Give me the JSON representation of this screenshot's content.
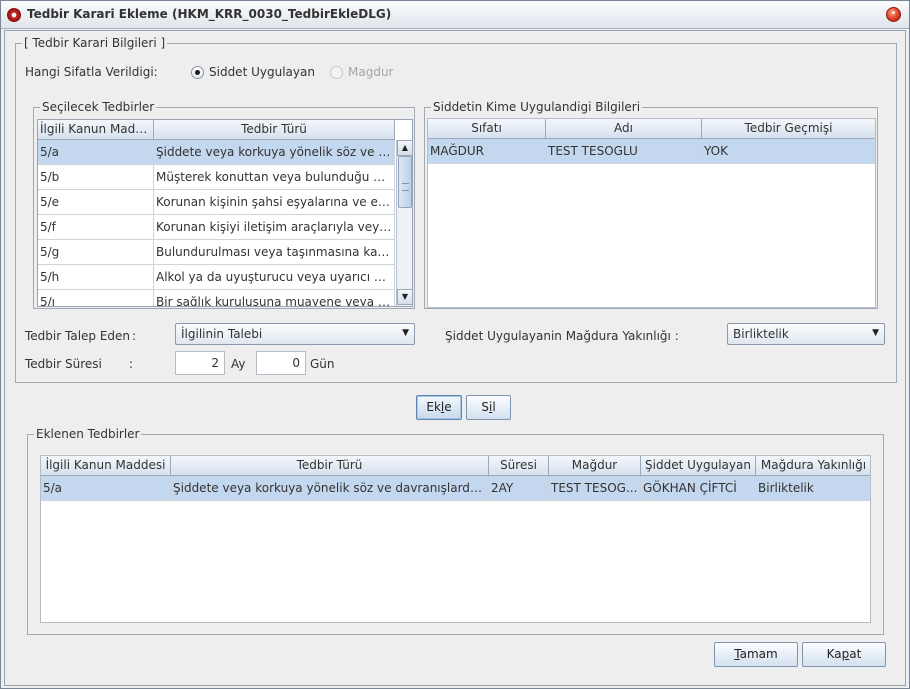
{
  "window": {
    "title": "Tedbir Karari Ekleme (HKM_KRR_0030_TedbirEkleDLG)"
  },
  "info_group": {
    "legend": "[ Tedbir Karari Bilgileri ]",
    "capacity_label": "Hangi Sifatla Verildigi:",
    "radio_perpetrator": "Siddet Uygulayan",
    "radio_victim": "Magdur",
    "selected_radio": "Siddet Uygulayan"
  },
  "measures_group": {
    "legend": "Seçilecek Tedbirler",
    "columns": [
      "İlgili Kanun Madde...",
      "Tedbir Türü"
    ],
    "rows": [
      {
        "article": "5/a",
        "type": "Şiddete veya korkuya yönelik söz ve davra...",
        "selected": true
      },
      {
        "article": "5/b",
        "type": "Müşterek konuttan veya bulunduğu yerden...",
        "selected": false
      },
      {
        "article": "5/e",
        "type": "Korunan kişinin şahsi eşyalarına ve ev eş...",
        "selected": false
      },
      {
        "article": "5/f",
        "type": "Korunan kişiyi iletişim araçlarıyla veya sai...",
        "selected": false
      },
      {
        "article": "5/g",
        "type": "Bulundurulması veya taşınmasına kanun...",
        "selected": false
      },
      {
        "article": "5/h",
        "type": "Alkol ya da uyuşturucu veya uyarıcı madde...",
        "selected": false
      },
      {
        "article": "5/ı",
        "type": "Bir sağlık kuruluşuna muayene veya tedav...",
        "selected": false
      }
    ],
    "scroll": {
      "up_icon": "▲",
      "down_icon": "▼"
    }
  },
  "applied_group": {
    "legend": "Siddetin Kime Uygulandigi Bilgileri",
    "columns": [
      "Sıfatı",
      "Adı",
      "Tedbir Geçmişi"
    ],
    "rows": [
      {
        "role": "MAĞDUR",
        "name": "TEST TESOGLU",
        "history": "YOK",
        "selected": true
      }
    ]
  },
  "form": {
    "requester_label": "Tedbir Talep Eden",
    "requester_colon": ":",
    "requester_value": "İlgilinin Talebi",
    "closeness_label": "Şiddet Uygulayanin Mağdura Yakınlığı :",
    "closeness_value": "Birliktelik",
    "duration_label": "Tedbir Süresi",
    "duration_colon": ":",
    "months_value": "2",
    "months_unit": "Ay",
    "days_value": "0",
    "days_unit": "Gün",
    "dropdown_icon": "▼"
  },
  "actions": {
    "add_label_pre": "Ek",
    "add_label_mn": "l",
    "add_label_post": "e",
    "delete_label_pre": "S",
    "delete_label_mn": "i",
    "delete_label_post": "l"
  },
  "added_group": {
    "legend": "Eklenen Tedbirler",
    "columns": [
      "İlgili Kanun Maddesi",
      "Tedbir Türü",
      "Süresi",
      "Mağdur",
      "Şiddet Uygulayan",
      "Mağdura Yakınlığı"
    ],
    "rows": [
      {
        "article": "5/a",
        "type": "Şiddete veya korkuya yönelik söz ve davranışlarda bulun...",
        "duration": "2AY",
        "victim": "TEST TESOG...",
        "perpetrator": "GÖKHAN ÇİFTCİ",
        "closeness": "Birliktelik",
        "selected": true
      }
    ]
  },
  "footer": {
    "ok_mn": "T",
    "ok_rest": "amam",
    "close_pre": "Ka",
    "close_mn": "p",
    "close_post": "at"
  }
}
